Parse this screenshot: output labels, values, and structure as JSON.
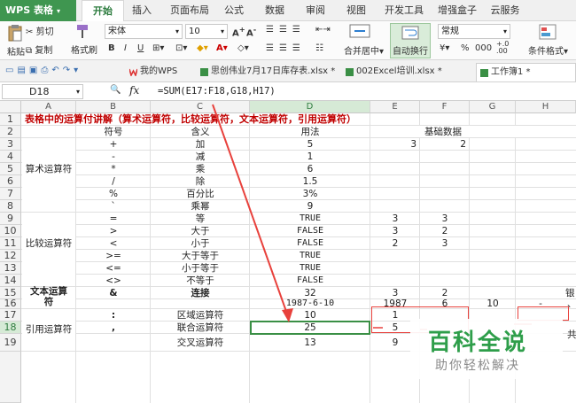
{
  "app": {
    "logo": "WPS 表格"
  },
  "tabs": [
    "开始",
    "插入",
    "页面布局",
    "公式",
    "数据",
    "审阅",
    "视图",
    "开发工具",
    "增强盒子",
    "云服务"
  ],
  "ribbon": {
    "paste": "粘贴",
    "cut": "剪切",
    "copy": "复制",
    "format_painter": "格式刷",
    "font_name": "宋体",
    "font_size": "10",
    "merge_center": "合并居中",
    "auto_wrap": "自动换行",
    "number_format": "常规",
    "cond_format": "条件格式"
  },
  "doc_tabs": [
    "我的WPS",
    "思创伟业7月17日库存表.xlsx *",
    "002Excel培训.xlsx *",
    "工作簿1 *"
  ],
  "formula_bar": {
    "name_box": "D18",
    "fx": "fx",
    "formula": "=SUM(E17:F18,G18,H17)"
  },
  "columns": [
    "A",
    "B",
    "C",
    "D",
    "E",
    "F",
    "G",
    "H"
  ],
  "rows": [
    "1",
    "2",
    "3",
    "4",
    "5",
    "6",
    "7",
    "8",
    "9",
    "10",
    "11",
    "12",
    "13",
    "14",
    "15",
    "16",
    "17",
    "18",
    "19"
  ],
  "sheet": {
    "title": "表格中的运算付讲解（算术运算符，比较运算符，文本运算符，引用运算符）",
    "header": {
      "symbol": "符号",
      "meaning": "含义",
      "usage": "用法",
      "basic": "基础数据"
    },
    "groups": {
      "arith": "算术运算符",
      "compare": "比较运算符",
      "text1": "文本运算",
      "text2": "符",
      "ref": "引用运算符"
    },
    "r3": {
      "b": "+",
      "c": "加",
      "d": "5",
      "e": "3",
      "f": "2"
    },
    "r4": {
      "b": "-",
      "c": "减",
      "d": "1"
    },
    "r5": {
      "b": "*",
      "c": "乘",
      "d": "6"
    },
    "r6": {
      "b": "/",
      "c": "除",
      "d": "1.5"
    },
    "r7": {
      "b": "%",
      "c": "百分比",
      "d": "3%"
    },
    "r8": {
      "b": "`",
      "c": "乘幂",
      "d": "9"
    },
    "r9": {
      "b": "=",
      "c": "等",
      "d": "TRUE",
      "e": "3",
      "f": "3"
    },
    "r10": {
      "b": ">",
      "c": "大于",
      "d": "FALSE",
      "e": "3",
      "f": "2"
    },
    "r11": {
      "b": "<",
      "c": "小于",
      "d": "FALSE",
      "e": "2",
      "f": "3"
    },
    "r12": {
      "b": ">=",
      "c": "大于等于",
      "d": "TRUE"
    },
    "r13": {
      "b": "<=",
      "c": "小于等于",
      "d": "TRUE"
    },
    "r14": {
      "b": "<>",
      "c": "不等于",
      "d": "FALSE"
    },
    "r15": {
      "b": "&",
      "c": "连接",
      "d": "32",
      "e": "3",
      "f": "2",
      "h": "银"
    },
    "r16": {
      "d": "1987-6-10",
      "e": "1987",
      "f": "6",
      "g": "10",
      "h": "-",
      "h2": "、"
    },
    "r17": {
      "b": ":",
      "c": "区域运算符",
      "d": "10",
      "e": "1"
    },
    "r18": {
      "b": ",",
      "c": "联合运算符",
      "d": "25",
      "e": "5"
    },
    "r19": {
      "c": "交叉运算符",
      "d": "13",
      "e": "9",
      "h": "共"
    }
  },
  "watermark": {
    "main": "百科全说",
    "sub": "助你轻松解决"
  },
  "colors": {
    "accent_green": "#3f9650",
    "title_red": "#c00000",
    "arrow_red": "#e8413c",
    "watermark_green": "#2e9e4a"
  }
}
